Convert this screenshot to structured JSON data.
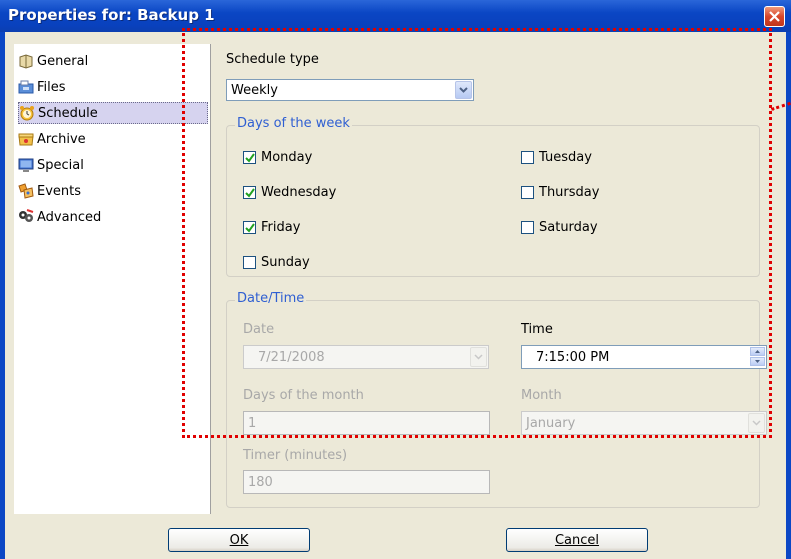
{
  "window": {
    "title": "Properties for: Backup 1"
  },
  "nav": {
    "items": [
      {
        "label": "General",
        "icon": "general-icon"
      },
      {
        "label": "Files",
        "icon": "files-icon"
      },
      {
        "label": "Schedule",
        "icon": "alarm-clock-icon",
        "selected": true
      },
      {
        "label": "Archive",
        "icon": "archive-icon"
      },
      {
        "label": "Special",
        "icon": "monitor-icon"
      },
      {
        "label": "Events",
        "icon": "events-icon"
      },
      {
        "label": "Advanced",
        "icon": "advanced-icon"
      }
    ]
  },
  "schedule": {
    "type_label": "Schedule type",
    "type_value": "Weekly",
    "days_group_title": "Days of the week",
    "days": [
      {
        "label": "Monday",
        "checked": true
      },
      {
        "label": "Tuesday",
        "checked": false
      },
      {
        "label": "Wednesday",
        "checked": true
      },
      {
        "label": "Thursday",
        "checked": false
      },
      {
        "label": "Friday",
        "checked": true
      },
      {
        "label": "Saturday",
        "checked": false
      },
      {
        "label": "Sunday",
        "checked": false
      }
    ],
    "datetime_group_title": "Date/Time",
    "date_label": "Date",
    "date_value": "7/21/2008",
    "time_label": "Time",
    "time_value": "7:15:00 PM",
    "dom_label": "Days of the month",
    "dom_value": "1",
    "month_label": "Month",
    "month_value": "January",
    "timer_label": "Timer (minutes)",
    "timer_value": "180"
  },
  "buttons": {
    "ok": "OK",
    "cancel": "Cancel"
  },
  "colors": {
    "titlebar": "#0a46c4",
    "dialog_bg": "#ece9d8",
    "group_title": "#2f5fd2",
    "annotation": "#e00000",
    "close": "#d8462b"
  }
}
